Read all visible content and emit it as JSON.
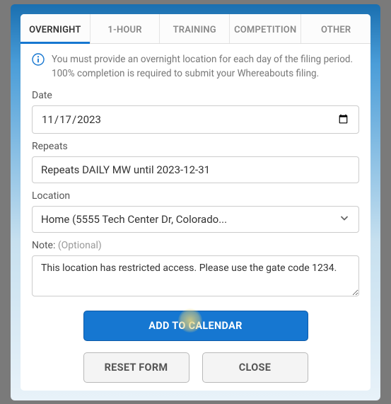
{
  "tabs": [
    {
      "label": "OVERNIGHT",
      "active": true
    },
    {
      "label": "1-HOUR",
      "active": false
    },
    {
      "label": "TRAINING",
      "active": false
    },
    {
      "label": "COMPETITION",
      "active": false
    },
    {
      "label": "OTHER",
      "active": false
    }
  ],
  "info_text": "You must provide an overnight location for each day of the filing period. 100% completion is required to submit your Whereabouts filing.",
  "date": {
    "label": "Date",
    "value": "2023-11-17",
    "display": "11/17/2023"
  },
  "repeats": {
    "label": "Repeats",
    "value": "Repeats DAILY MW until 2023-12-31"
  },
  "location": {
    "label": "Location",
    "selected": "Home (5555 Tech Center Dr, Colorado..."
  },
  "note": {
    "label": "Note:",
    "optional": "(Optional)",
    "value": "This location has restricted access. Please use the gate code 1234."
  },
  "buttons": {
    "add": "ADD TO CALENDAR",
    "reset": "RESET FORM",
    "close": "CLOSE"
  }
}
